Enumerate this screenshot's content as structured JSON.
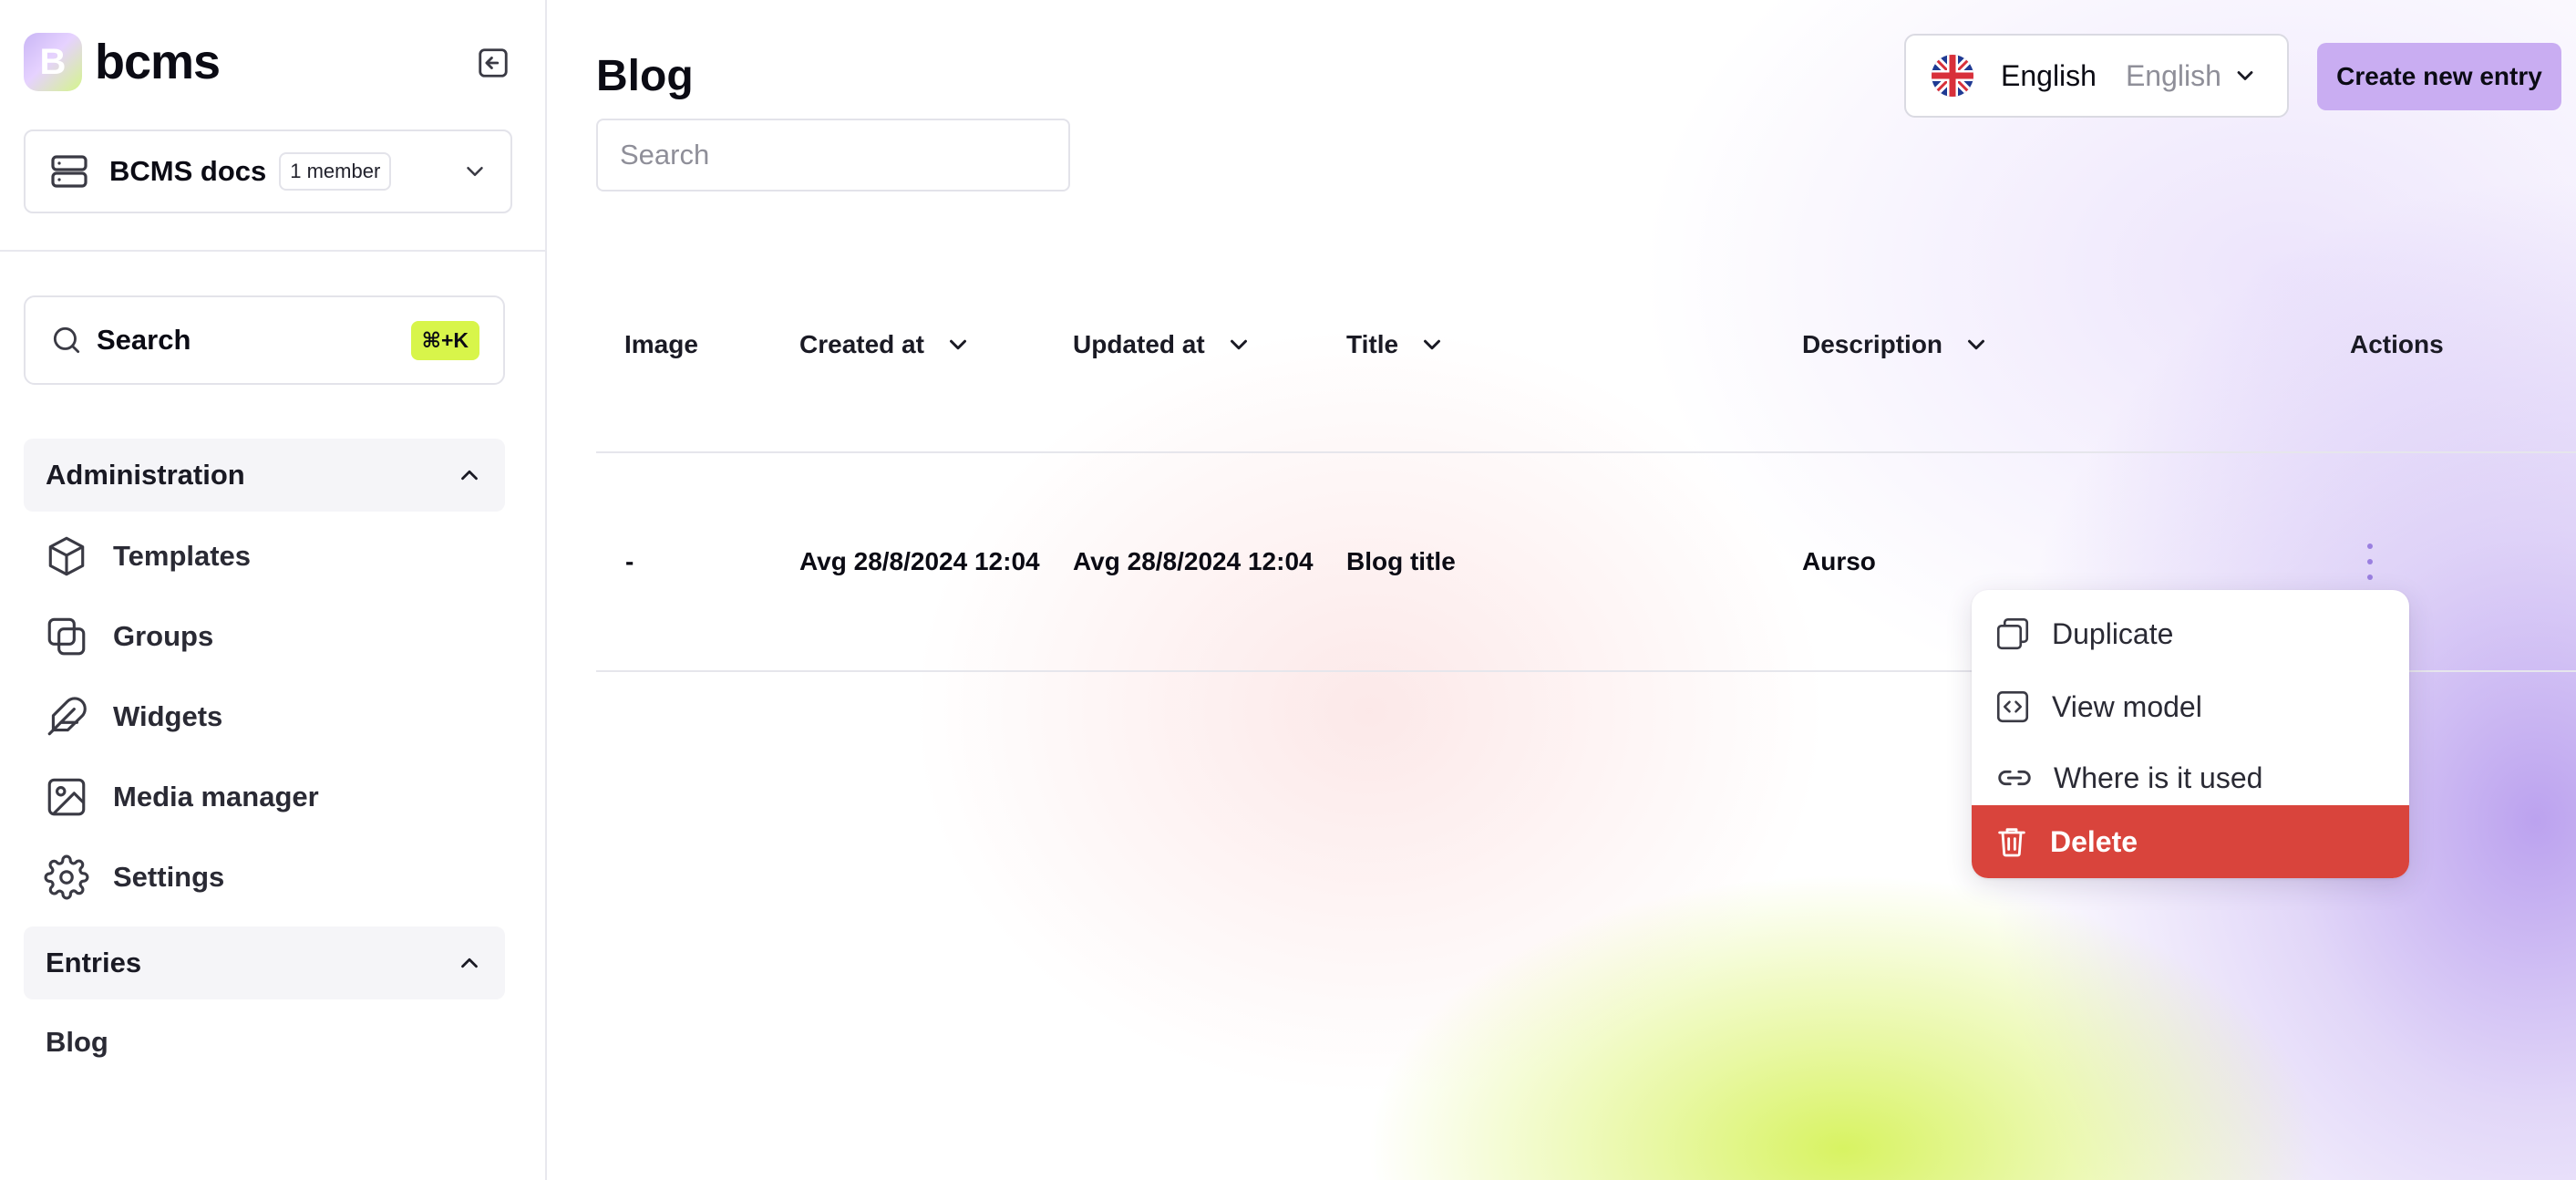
{
  "brand": {
    "name": "bcms",
    "logo_letter": "B"
  },
  "workspace": {
    "name": "BCMS docs",
    "members": "1 member"
  },
  "sidebar_search": {
    "label": "Search",
    "shortcut": "⌘+K"
  },
  "administration": {
    "title": "Administration",
    "items": [
      {
        "label": "Templates",
        "icon": "cube-icon"
      },
      {
        "label": "Groups",
        "icon": "groups-icon"
      },
      {
        "label": "Widgets",
        "icon": "feather-icon"
      },
      {
        "label": "Media manager",
        "icon": "image-icon"
      },
      {
        "label": "Settings",
        "icon": "gear-icon"
      }
    ]
  },
  "entries": {
    "title": "Entries",
    "items": [
      {
        "label": "Blog"
      }
    ]
  },
  "page": {
    "title": "Blog",
    "search_placeholder": "Search",
    "language": {
      "current": "English",
      "secondary": "English",
      "flag": "uk-flag-icon"
    },
    "create_button": "Create new entry"
  },
  "table": {
    "columns": [
      "Image",
      "Created at",
      "Updated at",
      "Title",
      "Description",
      "Actions"
    ],
    "rows": [
      {
        "image": "-",
        "created": "Avg 28/8/2024 12:04",
        "updated": "Avg 28/8/2024 12:04",
        "title": "Blog title",
        "description": "Aurso"
      }
    ]
  },
  "context_menu": {
    "items": [
      {
        "label": "Duplicate",
        "icon": "duplicate-icon"
      },
      {
        "label": "View model",
        "icon": "code-icon"
      },
      {
        "label": "Where is it used",
        "icon": "link-icon"
      },
      {
        "label": "Delete",
        "icon": "trash-icon"
      }
    ]
  },
  "colors": {
    "accent_purple": "#c9adf2",
    "shortcut_lime": "#d8f54a",
    "danger": "#d9443c",
    "kebab": "#9a7fe0"
  }
}
